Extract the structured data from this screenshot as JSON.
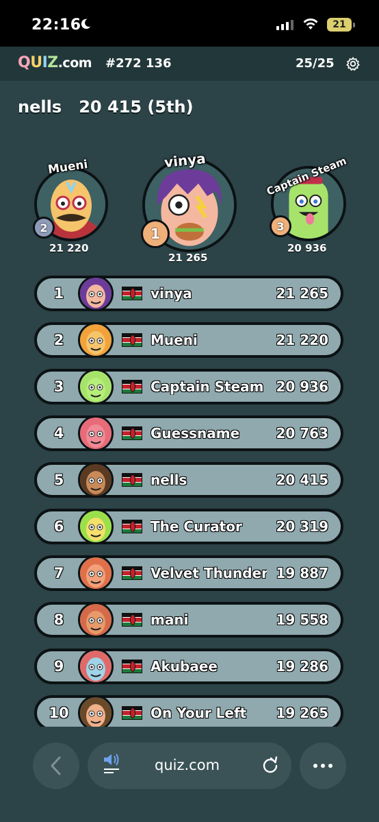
{
  "status_bar": {
    "time": "22:16",
    "battery": "21"
  },
  "app_header": {
    "logo": {
      "q": "Q",
      "u": "U",
      "i": "I",
      "z": "Z",
      "suffix": ".com"
    },
    "game_id": "#272 136",
    "progress": "25/25"
  },
  "player": {
    "name": "nells",
    "score": "20 415",
    "placement": "(5th)"
  },
  "podium": [
    {
      "rank": "1",
      "name": "vinya",
      "score": "21 265",
      "medal_color": "#f0b07a",
      "avatar_bg": "#7a3fa0"
    },
    {
      "rank": "2",
      "name": "Mueni",
      "score": "21 220",
      "medal_color": "#8f9cb8",
      "avatar_bg": "#f2a23a"
    },
    {
      "rank": "3",
      "name": "Captain Steam",
      "score": "20 936",
      "medal_color": "#f0b07a",
      "avatar_bg": "#a7e36b"
    }
  ],
  "leaderboard": [
    {
      "rank": "1",
      "name": "vinya",
      "score": "21 265",
      "avatar_color": "#6d3b9a",
      "face_color": "#f4b7a0"
    },
    {
      "rank": "2",
      "name": "Mueni",
      "score": "21 220",
      "avatar_color": "#f2a23a",
      "face_color": "#f5c46b"
    },
    {
      "rank": "3",
      "name": "Captain Steam",
      "score": "20 936",
      "avatar_color": "#a7e36b",
      "face_color": "#b6ee7a"
    },
    {
      "rank": "4",
      "name": "Guessname",
      "score": "20 763",
      "avatar_color": "#e86b7a",
      "face_color": "#f08a95"
    },
    {
      "rank": "5",
      "name": "nells",
      "score": "20 415",
      "avatar_color": "#5a3a22",
      "face_color": "#c98a5a"
    },
    {
      "rank": "6",
      "name": "The Curator",
      "score": "20 319",
      "avatar_color": "#9be04a",
      "face_color": "#f5e06b"
    },
    {
      "rank": "7",
      "name": "Velvet Thunder",
      "score": "19 887",
      "avatar_color": "#e0704a",
      "face_color": "#f2a07a"
    },
    {
      "rank": "8",
      "name": "mani",
      "score": "19 558",
      "avatar_color": "#d56a4a",
      "face_color": "#e89a6a"
    },
    {
      "rank": "9",
      "name": "Akubaee",
      "score": "19 286",
      "avatar_color": "#e06a6a",
      "face_color": "#9fd4e8"
    },
    {
      "rank": "10",
      "name": "On Your Left",
      "score": "19 265",
      "avatar_color": "#6b4a2a",
      "face_color": "#f0b08a"
    }
  ],
  "browser": {
    "url": "quiz.com"
  },
  "colors": {
    "background": "#2c4347",
    "row_fill": "#8fa9ae",
    "outline": "#0c1214",
    "kenya_red": "#c3222b",
    "kenya_green": "#1d7a3a"
  }
}
